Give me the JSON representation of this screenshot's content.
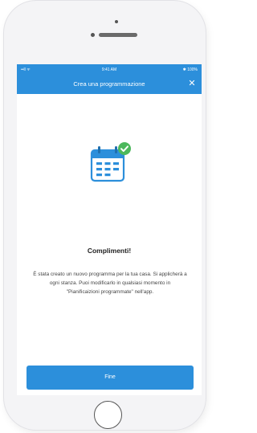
{
  "status_bar": {
    "signal": "••ll ᯤ",
    "time": "9:41 AM",
    "battery": "✱ 100%"
  },
  "nav": {
    "title": "Crea una programmazione",
    "close_glyph": "✕"
  },
  "content": {
    "heading": "Complimenti!",
    "message": "È stata creato un nuovo programma per la tua casa. Si applicherà a ogni stanza. Puoi modificarlo in qualsiasi momento in \"Pianificaizioni programmate\" nell'app."
  },
  "actions": {
    "done_label": "Fine"
  },
  "colors": {
    "accent": "#2c8fdb",
    "success": "#4cb85c"
  },
  "icons": {
    "illustration": "calendar-check-icon",
    "close": "close-icon"
  }
}
